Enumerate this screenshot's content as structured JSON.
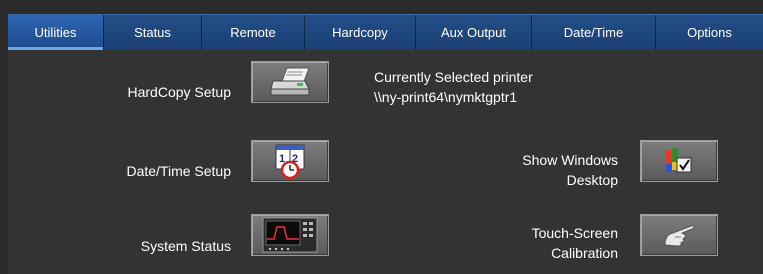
{
  "tabs": [
    {
      "label": "Utilities",
      "active": true
    },
    {
      "label": "Status",
      "active": false
    },
    {
      "label": "Remote",
      "active": false
    },
    {
      "label": "Hardcopy",
      "active": false
    },
    {
      "label": "Aux Output",
      "active": false
    },
    {
      "label": "Date/Time",
      "active": false
    },
    {
      "label": "Options",
      "active": false
    }
  ],
  "utilities": {
    "hardcopy_setup_label": "HardCopy Setup",
    "date_time_setup_label": "Date/Time Setup",
    "system_status_label": "System Status",
    "printer_heading": "Currently Selected printer",
    "printer_path": "\\\\ny-print64\\nymktgptr1",
    "show_windows_desktop_line1": "Show Windows",
    "show_windows_desktop_line2": "Desktop",
    "touch_screen_line1": "Touch-Screen",
    "touch_screen_line2": "Calibration"
  },
  "icons": {
    "hardcopy": "printer-icon",
    "date_time": "calendar-clock-icon",
    "system_status": "oscilloscope-icon",
    "desktop": "windows-desktop-icon",
    "touch": "pointing-hand-icon"
  },
  "colors": {
    "tab_bar": "#1b3f73",
    "tab_active": "#2e66b4",
    "panel_bg": "#333333"
  }
}
